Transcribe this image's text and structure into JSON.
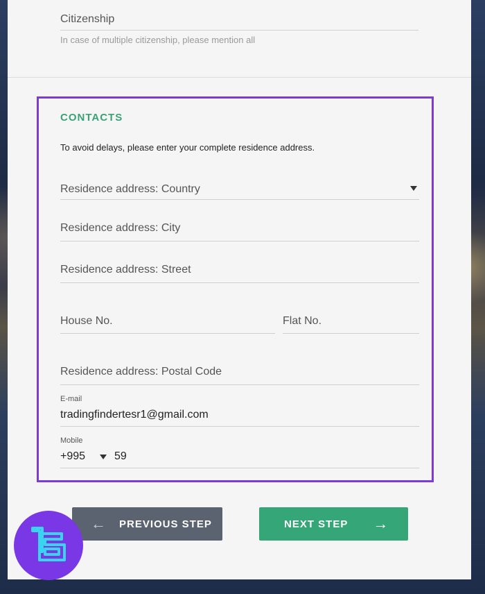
{
  "citizenship": {
    "label": "Citizenship",
    "hint": "In case of multiple citizenship, please mention all"
  },
  "contacts": {
    "title": "CONTACTS",
    "intro": "To avoid delays, please enter your complete residence address.",
    "country_placeholder": "Residence address: Country",
    "city_placeholder": "Residence address: City",
    "street_placeholder": "Residence address: Street",
    "house_placeholder": "House No.",
    "flat_placeholder": "Flat No.",
    "postal_placeholder": "Residence address: Postal Code",
    "email_label": "E-mail",
    "email_value": "tradingfindertesr1@gmail.com",
    "mobile_label": "Mobile",
    "mobile_code": "+995",
    "mobile_value": "59"
  },
  "buttons": {
    "previous": "PREVIOUS STEP",
    "next": "NEXT STEP",
    "left_arrow": "←",
    "right_arrow": "→"
  },
  "colors": {
    "accent_green": "#35a677",
    "highlight_purple": "#7a3bd6",
    "logo_purple": "#7a37e6",
    "logo_cyan": "#39d4f0"
  },
  "logo": {
    "icon": "tradingfinder-logo-icon"
  }
}
